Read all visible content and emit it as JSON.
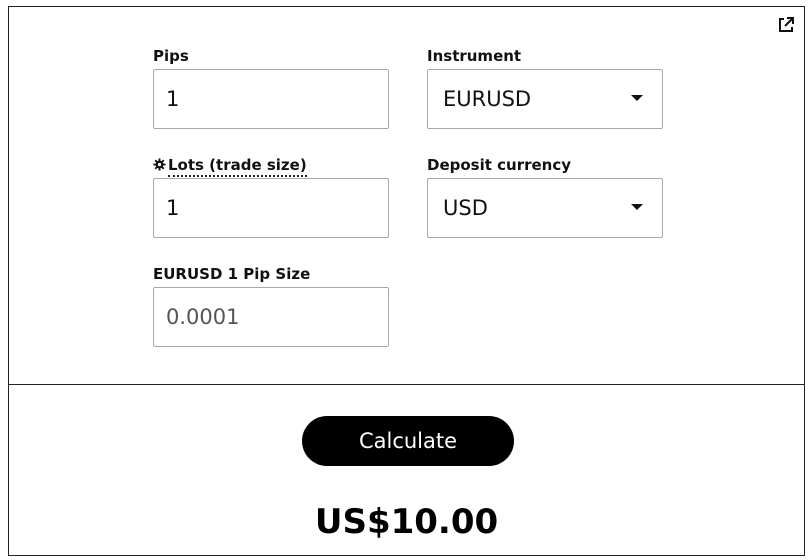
{
  "form": {
    "pips": {
      "label": "Pips",
      "value": "1"
    },
    "instrument": {
      "label": "Instrument",
      "value": "EURUSD"
    },
    "lots": {
      "label": "Lots (trade size)",
      "value": "1"
    },
    "deposit_currency": {
      "label": "Deposit currency",
      "value": "USD"
    },
    "pip_size": {
      "label": "EURUSD 1 Pip Size",
      "value": "0.0001"
    }
  },
  "actions": {
    "calculate_label": "Calculate"
  },
  "result": {
    "value": "US$10.00"
  },
  "icons": {
    "external_link": "external-link-icon",
    "settings": "gear-icon",
    "dropdown": "caret-down-icon"
  }
}
